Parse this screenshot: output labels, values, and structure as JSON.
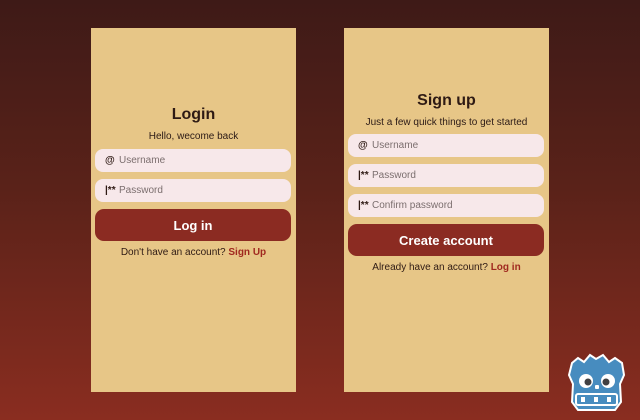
{
  "login": {
    "title": "Login",
    "subtitle": "Hello, wecome back",
    "username_placeholder": "Username",
    "password_placeholder": "Password",
    "submit_label": "Log in",
    "switch_prompt": "Don't have an account?",
    "switch_link": "Sign Up"
  },
  "signup": {
    "title": "Sign up",
    "subtitle": "Just a few quick things to get started",
    "username_placeholder": "Username",
    "password_placeholder": "Password",
    "confirm_placeholder": "Confirm password",
    "submit_label": "Create account",
    "switch_prompt": "Already have an account?",
    "switch_link": "Log in"
  },
  "icons": {
    "user": "@",
    "password": "|**"
  },
  "colors": {
    "panel": "#e7c687",
    "field": "#f7e8ea",
    "button": "#8b2b22",
    "link": "#a0281f",
    "logo_blue": "#478cbf"
  },
  "logo": {
    "name": "godot-logo-icon"
  }
}
